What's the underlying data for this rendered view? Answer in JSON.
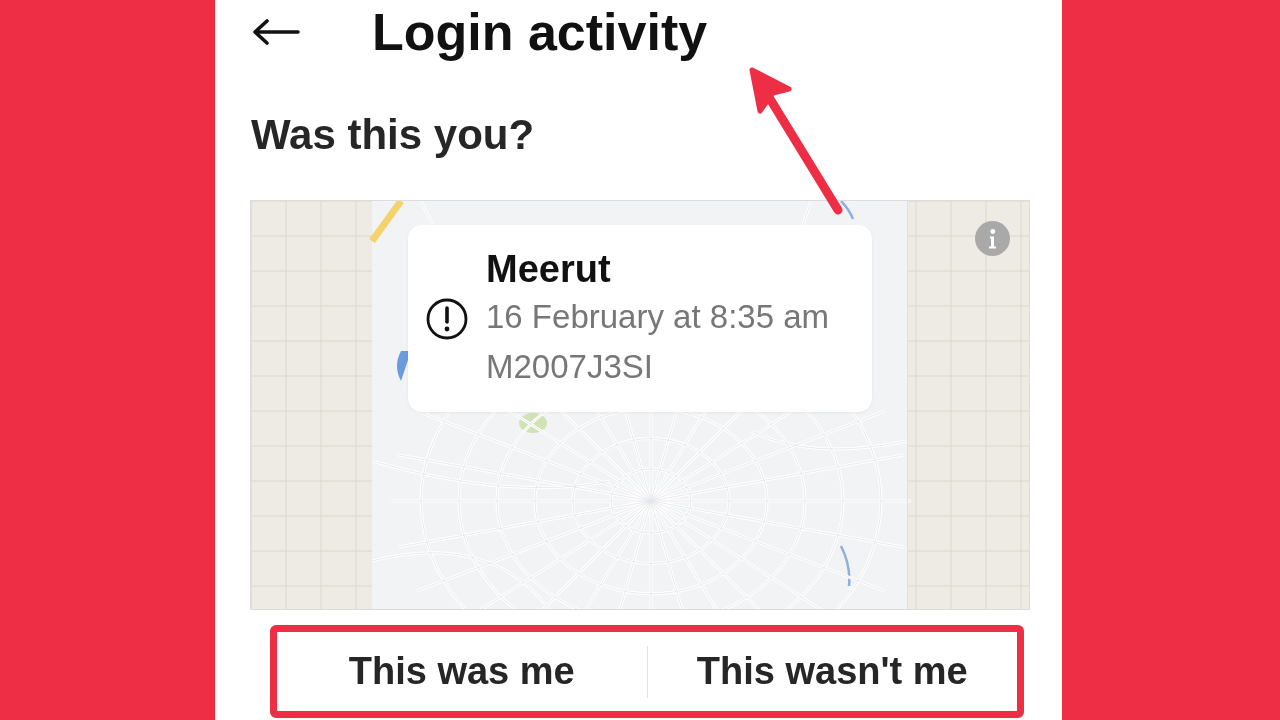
{
  "header": {
    "title": "Login activity"
  },
  "prompt": "Was this you?",
  "login": {
    "location": "Meerut",
    "time": "16 February at 8:35 am",
    "device": "M2007J3SI"
  },
  "actions": [
    {
      "label": "This was me"
    },
    {
      "label": "This wasn't me"
    }
  ]
}
